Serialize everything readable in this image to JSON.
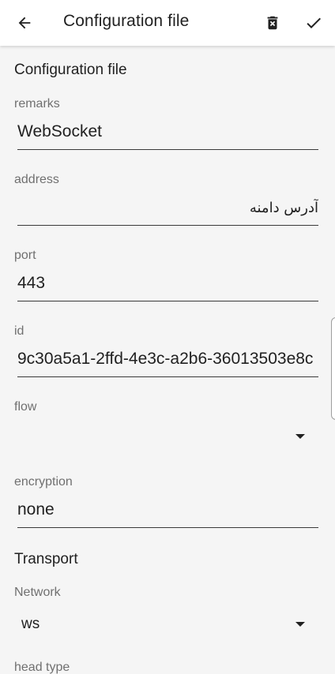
{
  "appbar": {
    "title": "Configuration file",
    "back_icon": "arrow-left-icon",
    "delete_icon": "delete-icon",
    "save_icon": "check-icon"
  },
  "section_config": {
    "title": "Configuration file"
  },
  "fields": {
    "remarks": {
      "label": "remarks",
      "value": "WebSocket"
    },
    "address": {
      "label": "address",
      "value": "آدرس دامنه"
    },
    "port": {
      "label": "port",
      "value": "443"
    },
    "id": {
      "label": "id",
      "value": "9c30a5a1-2ffd-4e3c-a2b6-36013503e8c"
    },
    "flow": {
      "label": "flow",
      "value": ""
    },
    "encryption": {
      "label": "encryption",
      "value": "none"
    }
  },
  "section_transport": {
    "title": "Transport"
  },
  "network": {
    "label": "Network",
    "value": "ws"
  },
  "head_type": {
    "label": "head type"
  }
}
